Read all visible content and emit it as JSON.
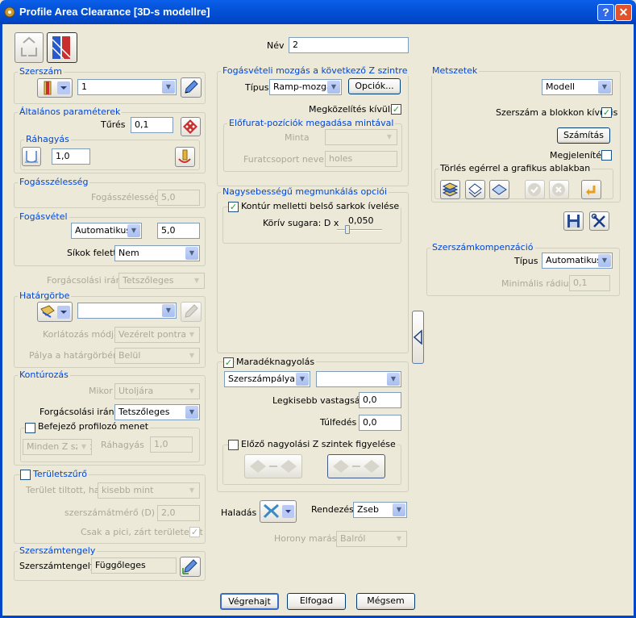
{
  "window": {
    "title": "Profile Area Clearance [3D-s modellre]",
    "help": "?",
    "close": "✕"
  },
  "name": {
    "label": "Név",
    "value": "2"
  },
  "tool": {
    "title": "Szerszám",
    "value": "1"
  },
  "general": {
    "title": "Általános paraméterek",
    "tolerance_label": "Tűrés",
    "tolerance": "0,1",
    "allowance_title": "Ráhagyás",
    "allowance": "1,0"
  },
  "stepover": {
    "title": "Fogásszélesség",
    "label": "Fogásszélesség",
    "value": "5,0"
  },
  "stepdown": {
    "title": "Fogásvétel",
    "mode": "Automatikus",
    "value": "5,0",
    "above_label": "Síkok felett",
    "above": "Nem"
  },
  "cut_direction": {
    "label": "Forgácsolási irány",
    "value": "Tetszőleges"
  },
  "boundary": {
    "title": "Határgörbe",
    "value": "",
    "limit_label": "Korlátozás módja",
    "limit": "Vezérelt pontra",
    "path_label": "Pálya a határgörbén",
    "path": "Belül"
  },
  "contour": {
    "title": "Kontúrozás",
    "when_label": "Mikor",
    "when": "Utoljára",
    "dir_label": "Forgácsolási irány",
    "dir": "Tetszőleges",
    "final_label": "Befejező profilozó menet",
    "final_levels": "Minden Z szint",
    "final_allow_label": "Ráhagyás",
    "final_allow": "1,0"
  },
  "area_filter": {
    "title": "Területszűrő",
    "forbidden_label": "Terület tiltott, ha",
    "forbidden": "kisebb mint",
    "diam_label": "szerszámátmérő (D) x",
    "diam": "2,0",
    "closed_label": "Csak a pici, zárt területeket"
  },
  "tool_axis": {
    "title": "Szerszámtengely",
    "label": "Szerszámtengely",
    "value": "Függőleges"
  },
  "approach": {
    "title": "Fogásvételi mozgás a következő Z szintre",
    "type_label": "Típus",
    "type": "Ramp-mozgás",
    "options": "Opciók...",
    "outside_label": "Megközelítés kívülről",
    "predrill_title": "Előfurat-pozíciók megadása mintával",
    "pattern_label": "Minta",
    "pattern": "",
    "holes_label": "Furatcsoport neve",
    "holes": "holes"
  },
  "hsm": {
    "title": "Nagysebességű megmunkálás opciói",
    "corner_label": "Kontúr melletti belső sarkok ívelése",
    "radius_label": "Körív sugara: D x",
    "radius": "0,050"
  },
  "rest": {
    "label": "Maradéknagyolás",
    "mode": "Szerszámpálya",
    "ref": "",
    "thickness_label": "Legkisebb vastagság",
    "thickness": "0,0",
    "overlap_label": "Túlfedés",
    "overlap": "0,0",
    "prev_label": "Előző nagyolási Z szintek figyelése"
  },
  "order": {
    "progress_label": "Haladás",
    "sort_label": "Rendezés",
    "sort": "Zseb",
    "slot_label": "Horony marása",
    "slot": "Balról"
  },
  "slices": {
    "title": "Metszetek",
    "mode": "Modell",
    "outside_label": "Szerszám a blokkon kívül is",
    "calc": "Számítás",
    "show_label": "Megjelenítés",
    "delete_title": "Törlés egérrel a grafikus ablakban"
  },
  "comp": {
    "title": "Szerszámkompenzáció",
    "type_label": "Típus",
    "type": "Automatikus",
    "minrad_label": "Minimális rádiusz",
    "minrad": "0,1"
  },
  "buttons": {
    "ok": "Végrehajt",
    "accept": "Elfogad",
    "cancel": "Mégsem"
  }
}
